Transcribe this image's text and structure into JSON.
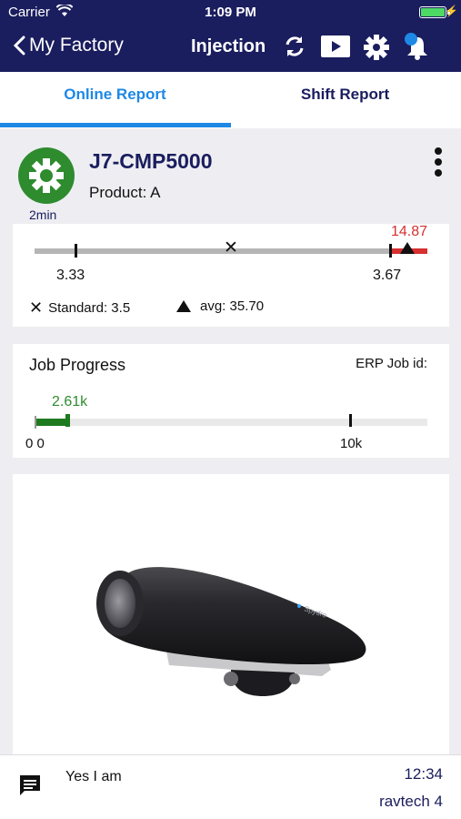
{
  "status_bar": {
    "carrier": "Carrier",
    "time": "1:09 PM"
  },
  "nav": {
    "back_label": "My Factory",
    "title": "Injection",
    "icons": [
      "refresh-icon",
      "play-icon",
      "gear-icon",
      "bell-icon"
    ],
    "colors": {
      "bar": "#1a1d5e",
      "notification_dot": "#1e88e5"
    }
  },
  "tabs": {
    "active": "Online Report",
    "inactive": "Shift Report",
    "accent": "#1e88e5"
  },
  "machine": {
    "name": "J7-CMP5000",
    "product": "Product: A",
    "status_time": "2min",
    "status_color": "#2e8b2e"
  },
  "cycle_range": {
    "lower_limit": "3.33",
    "upper_limit": "3.67",
    "current": "14.87",
    "current_color": "#d63030",
    "standard_legend": "Standard: 3.5",
    "avg_legend": "avg: 35.70"
  },
  "job_progress": {
    "title": "Job Progress",
    "erp_label": "ERP Job id:",
    "start_label": "0 0",
    "target_label": "10k",
    "progress_label": "2.61k",
    "progress_fraction": 0.261,
    "progress_color": "#1e7a1e"
  },
  "chat": {
    "message": "Yes I am",
    "time": "12:34",
    "user": "ravtech 4",
    "brand_text": "Spydro"
  }
}
